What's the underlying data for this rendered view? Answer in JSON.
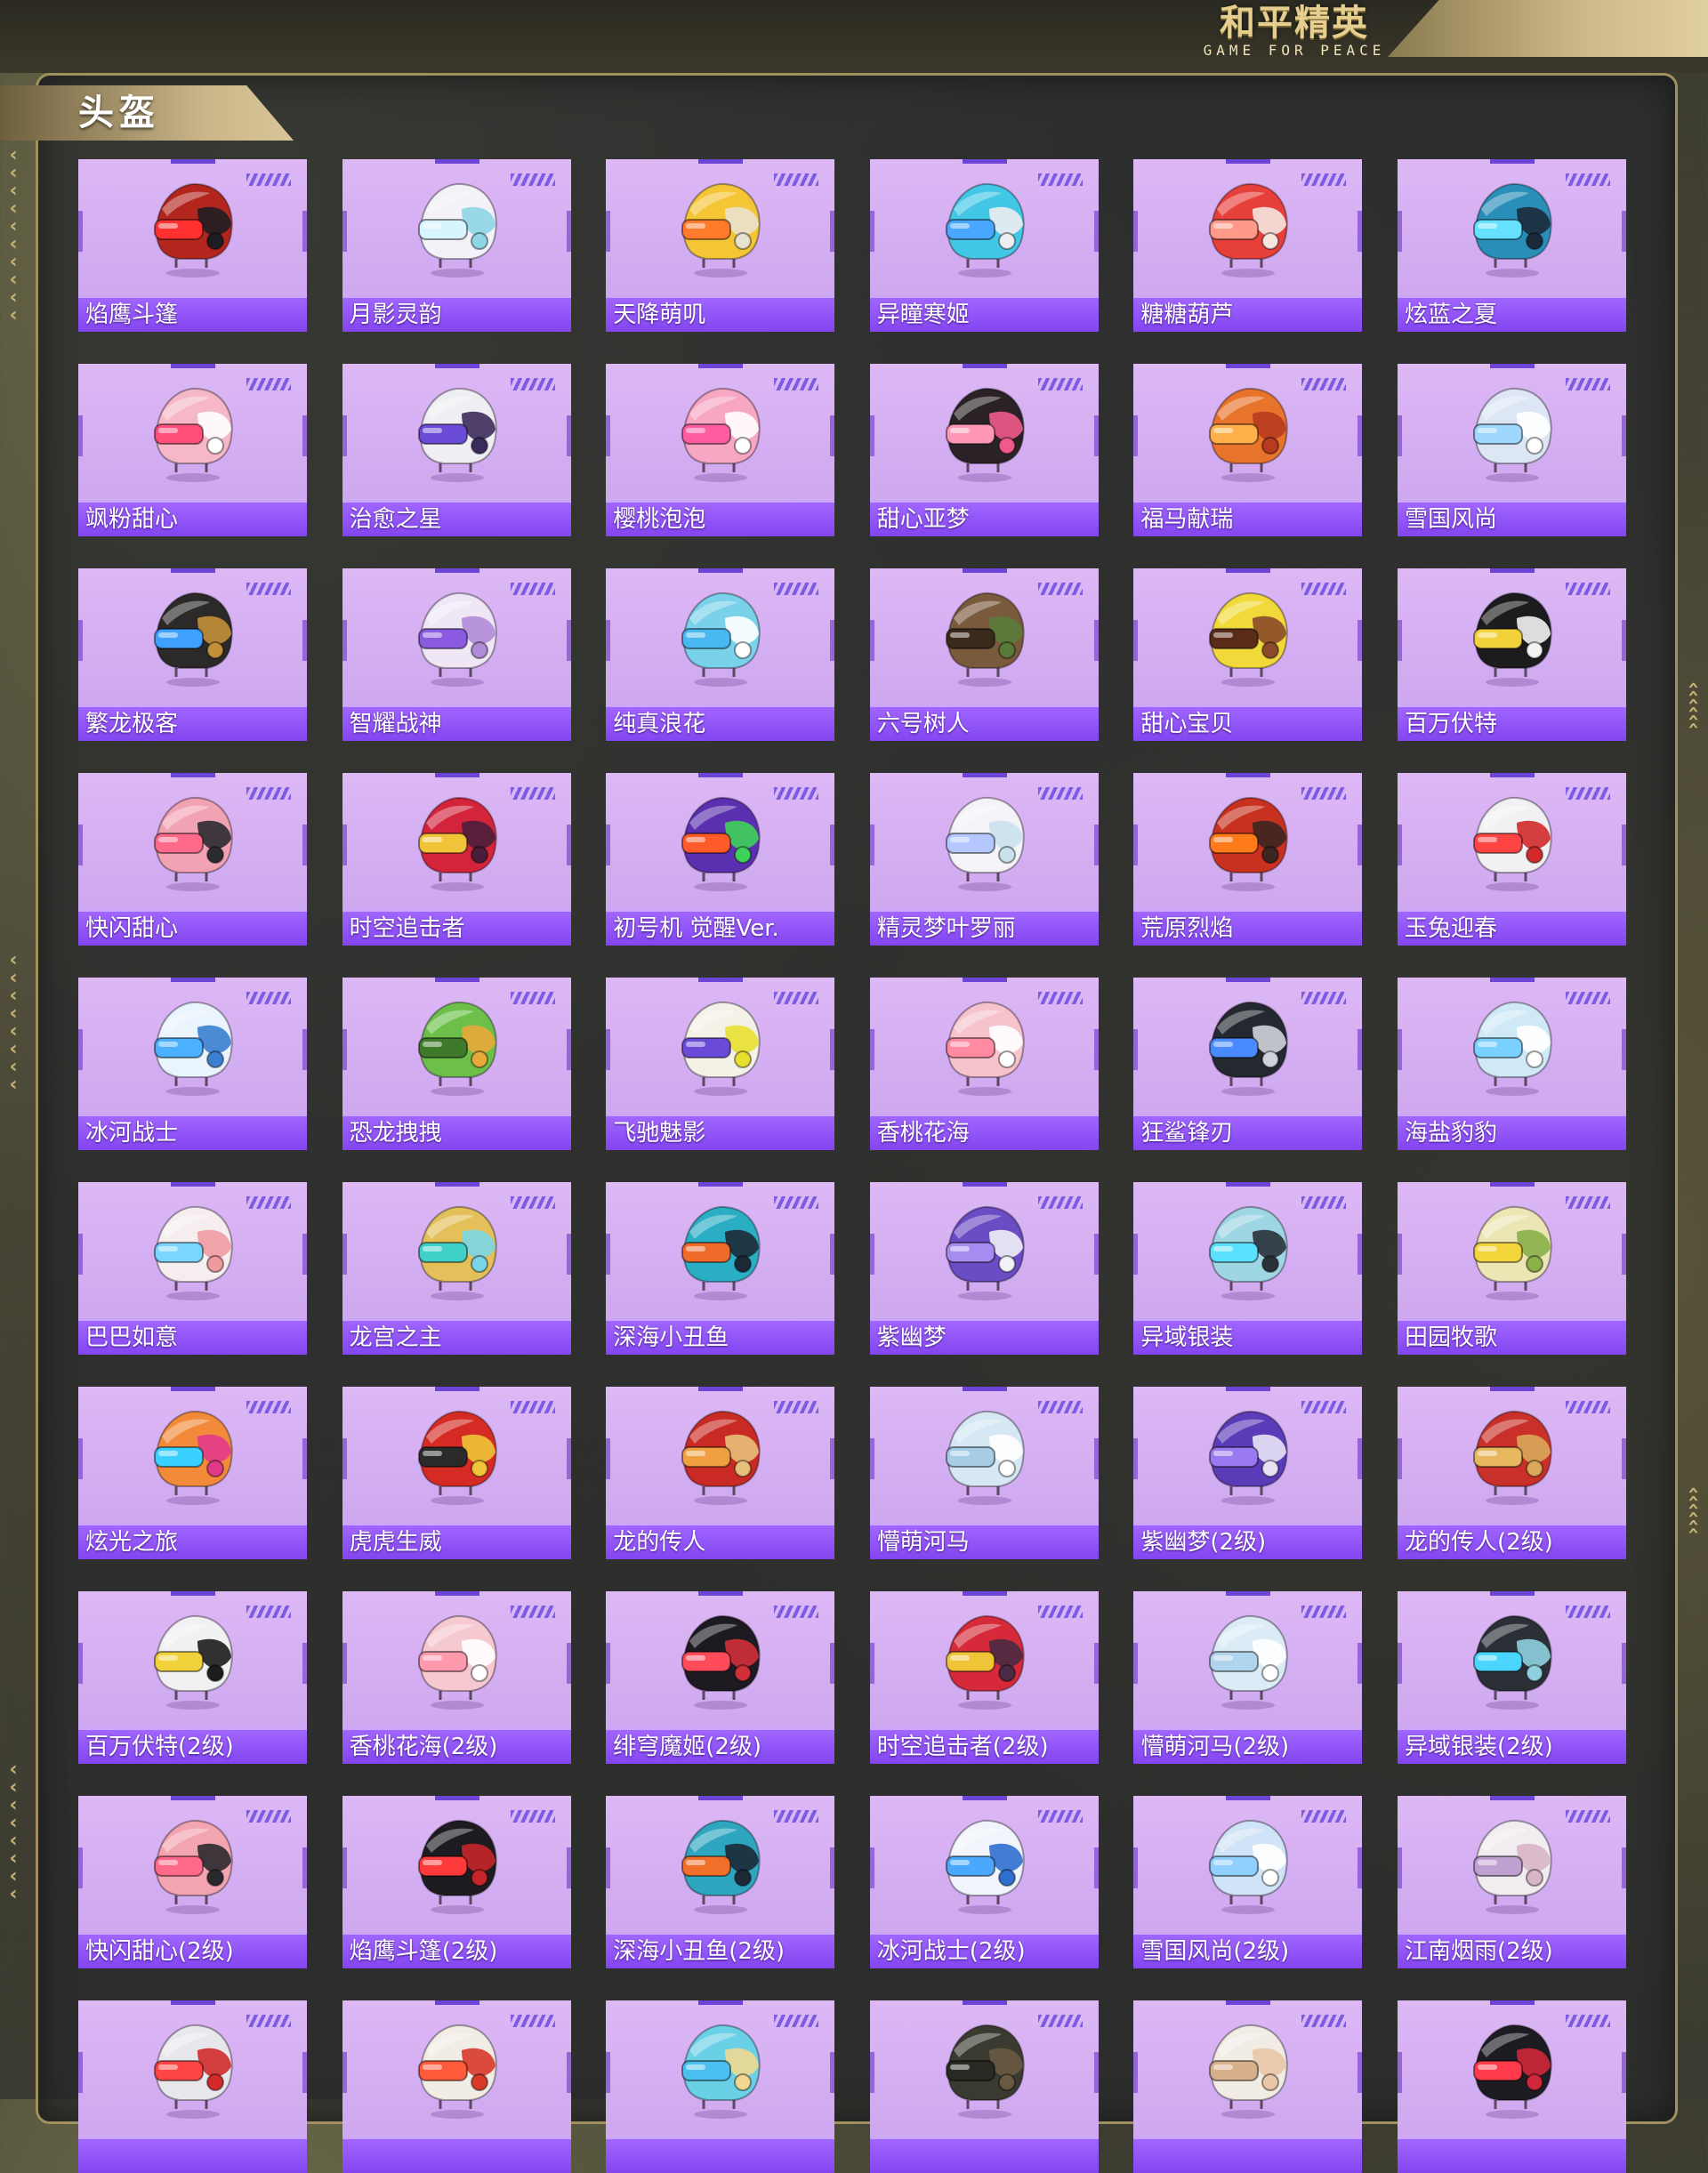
{
  "logo": {
    "main": "和平精英",
    "sub": "GAME FOR PEACE"
  },
  "section_title": "头盔",
  "helmets": [
    {
      "name": "焰鹰斗篷",
      "primary": "#b3261e",
      "secondary": "#1e1e22",
      "visor": "#ff3030"
    },
    {
      "name": "月影灵韵",
      "primary": "#f2f2f8",
      "secondary": "#8fd6e4",
      "visor": "#d8f4ff"
    },
    {
      "name": "天降萌叽",
      "primary": "#f4c636",
      "secondary": "#e9e2cf",
      "visor": "#ff7a2a"
    },
    {
      "name": "异瞳寒姬",
      "primary": "#43c7e6",
      "secondary": "#eeeef2",
      "visor": "#49a7ff"
    },
    {
      "name": "糖糖葫芦",
      "primary": "#e7403a",
      "secondary": "#f5e6e0",
      "visor": "#ff9a8a"
    },
    {
      "name": "炫蓝之夏",
      "primary": "#2a8fb8",
      "secondary": "#1b2a3a",
      "visor": "#65e0ff"
    },
    {
      "name": "飒粉甜心",
      "primary": "#f6b8c8",
      "secondary": "#ffffff",
      "visor": "#ff4f7a"
    },
    {
      "name": "治愈之星",
      "primary": "#efeff3",
      "secondary": "#3b2b5a",
      "visor": "#6a4bd8"
    },
    {
      "name": "樱桃泡泡",
      "primary": "#f7a6c4",
      "secondary": "#ffffff",
      "visor": "#ff5da0"
    },
    {
      "name": "甜心亚梦",
      "primary": "#2a2226",
      "secondary": "#f05a8a",
      "visor": "#ff98b7"
    },
    {
      "name": "福马献瑞",
      "primary": "#e8742c",
      "secondary": "#b83b20",
      "visor": "#ffb04a"
    },
    {
      "name": "雪国风尚",
      "primary": "#dce6f5",
      "secondary": "#ffffff",
      "visor": "#9fd8ff"
    },
    {
      "name": "繁龙极客",
      "primary": "#2c2a28",
      "secondary": "#c4903a",
      "visor": "#3ea0ff"
    },
    {
      "name": "智耀战神",
      "primary": "#efe6f6",
      "secondary": "#b08bd8",
      "visor": "#8a5be0"
    },
    {
      "name": "纯真浪花",
      "primary": "#7ad2ea",
      "secondary": "#ffffff",
      "visor": "#4ab8f0"
    },
    {
      "name": "六号树人",
      "primary": "#7a5a3c",
      "secondary": "#5b7a3a",
      "visor": "#3a2a1c"
    },
    {
      "name": "甜心宝贝",
      "primary": "#f1d93a",
      "secondary": "#8a4a2a",
      "visor": "#5a2c18"
    },
    {
      "name": "百万伏特",
      "primary": "#1c1c1e",
      "secondary": "#f3f3f3",
      "visor": "#f2d23a"
    },
    {
      "name": "快闪甜心",
      "primary": "#f1a3b4",
      "secondary": "#2b2b30",
      "visor": "#ff6a8a"
    },
    {
      "name": "时空追击者",
      "primary": "#d4243c",
      "secondary": "#4a1e3a",
      "visor": "#f0c438"
    },
    {
      "name": "初号机 觉醒Ver.",
      "primary": "#5a2fb0",
      "secondary": "#3ed15a",
      "visor": "#ff5a2a"
    },
    {
      "name": "精灵梦叶罗丽",
      "primary": "#f4f4f8",
      "secondary": "#c9e2ee",
      "visor": "#b4c8ff"
    },
    {
      "name": "荒原烈焰",
      "primary": "#c8311f",
      "secondary": "#3b2620",
      "visor": "#ff7a1a"
    },
    {
      "name": "玉兔迎春",
      "primary": "#f1f1f3",
      "secondary": "#d22a2a",
      "visor": "#ff4444"
    },
    {
      "name": "冰河战士",
      "primary": "#eaf4fc",
      "secondary": "#3a7fd0",
      "visor": "#4ab0ff"
    },
    {
      "name": "恐龙拽拽",
      "primary": "#6cc04a",
      "secondary": "#e8a93a",
      "visor": "#3e7a2a"
    },
    {
      "name": "飞驰魅影",
      "primary": "#f4f2e6",
      "secondary": "#e8e030",
      "visor": "#6a4bd8"
    },
    {
      "name": "香桃花海",
      "primary": "#f6c2cc",
      "secondary": "#ffffff",
      "visor": "#ff8aa2"
    },
    {
      "name": "狂鲨锋刃",
      "primary": "#242830",
      "secondary": "#d0d4da",
      "visor": "#4a8aff"
    },
    {
      "name": "海盐豹豹",
      "primary": "#cfeaf6",
      "secondary": "#ffffff",
      "visor": "#7ad0ff"
    },
    {
      "name": "巴巴如意",
      "primary": "#f6eeee",
      "secondary": "#f09aa0",
      "visor": "#7ad6ff"
    },
    {
      "name": "龙宫之主",
      "primary": "#e4c05a",
      "secondary": "#7ad6e6",
      "visor": "#40d0c8"
    },
    {
      "name": "深海小丑鱼",
      "primary": "#2aaec4",
      "secondary": "#1c2a38",
      "visor": "#f06a2a"
    },
    {
      "name": "紫幽梦",
      "primary": "#6a4cc4",
      "secondary": "#f1f1f6",
      "visor": "#a68cf0"
    },
    {
      "name": "异域银装",
      "primary": "#9fd6e4",
      "secondary": "#2a3238",
      "visor": "#5ae0ff"
    },
    {
      "name": "田园牧歌",
      "primary": "#ebe6b4",
      "secondary": "#8ab04a",
      "visor": "#f3d43a"
    },
    {
      "name": "炫光之旅",
      "primary": "#f28a3a",
      "secondary": "#e23a8a",
      "visor": "#3ad0ff"
    },
    {
      "name": "虎虎生威",
      "primary": "#d62a24",
      "secondary": "#f0c438",
      "visor": "#2a2a2a"
    },
    {
      "name": "龙的传人",
      "primary": "#c92a24",
      "secondary": "#e8c07a",
      "visor": "#f0a040"
    },
    {
      "name": "懵萌河马",
      "primary": "#d6e8f4",
      "secondary": "#ffffff",
      "visor": "#a6cce6"
    },
    {
      "name": "紫幽梦(2级)",
      "primary": "#5a3cb8",
      "secondary": "#e8e4f6",
      "visor": "#9a7af0"
    },
    {
      "name": "龙的传人(2级)",
      "primary": "#c9302a",
      "secondary": "#d9a85a",
      "visor": "#e8b860"
    },
    {
      "name": "百万伏特(2级)",
      "primary": "#f1f1f3",
      "secondary": "#1c1c1e",
      "visor": "#f2d23a"
    },
    {
      "name": "香桃花海(2级)",
      "primary": "#f6c8d0",
      "secondary": "#ffffff",
      "visor": "#ff9aae"
    },
    {
      "name": "绯穹魔姬(2级)",
      "primary": "#1e1a22",
      "secondary": "#d0303a",
      "visor": "#ff4a5a"
    },
    {
      "name": "时空追击者(2级)",
      "primary": "#d62a3a",
      "secondary": "#4a2a44",
      "visor": "#f0c438"
    },
    {
      "name": "懵萌河马(2级)",
      "primary": "#dcecf6",
      "secondary": "#ffffff",
      "visor": "#b0d4ec"
    },
    {
      "name": "异域银装(2级)",
      "primary": "#2a3036",
      "secondary": "#8fd0e0",
      "visor": "#4ad6ff"
    },
    {
      "name": "快闪甜心(2级)",
      "primary": "#f2a4b0",
      "secondary": "#2a2a2e",
      "visor": "#ff6a8a"
    },
    {
      "name": "焰鹰斗篷(2级)",
      "primary": "#1e1c20",
      "secondary": "#c4262a",
      "visor": "#ff3a3a"
    },
    {
      "name": "深海小丑鱼(2级)",
      "primary": "#2ea6c0",
      "secondary": "#1c2a38",
      "visor": "#f0702a"
    },
    {
      "name": "冰河战士(2级)",
      "primary": "#f1f5fb",
      "secondary": "#2f6fd0",
      "visor": "#4aa8ff"
    },
    {
      "name": "雪国风尚(2级)",
      "primary": "#cfe4f6",
      "secondary": "#ffffff",
      "visor": "#8fd0ff"
    },
    {
      "name": "江南烟雨(2级)",
      "primary": "#f1ecef",
      "secondary": "#d8b6c6",
      "visor": "#c0a0d0"
    },
    {
      "name": "",
      "primary": "#e8e8ec",
      "secondary": "#d22a2a",
      "visor": "#ff4444"
    },
    {
      "name": "",
      "primary": "#f1ece4",
      "secondary": "#d83a2a",
      "visor": "#ff5a3a"
    },
    {
      "name": "",
      "primary": "#6ad0e6",
      "secondary": "#f0d890",
      "visor": "#4ac0f0"
    },
    {
      "name": "",
      "primary": "#3a3a30",
      "secondary": "#6a5a44",
      "visor": "#2a2a24"
    },
    {
      "name": "",
      "primary": "#f1ece4",
      "secondary": "#e8c6a6",
      "visor": "#d6b08a"
    },
    {
      "name": "",
      "primary": "#1c1c22",
      "secondary": "#d0283a",
      "visor": "#ff3a4a"
    }
  ]
}
